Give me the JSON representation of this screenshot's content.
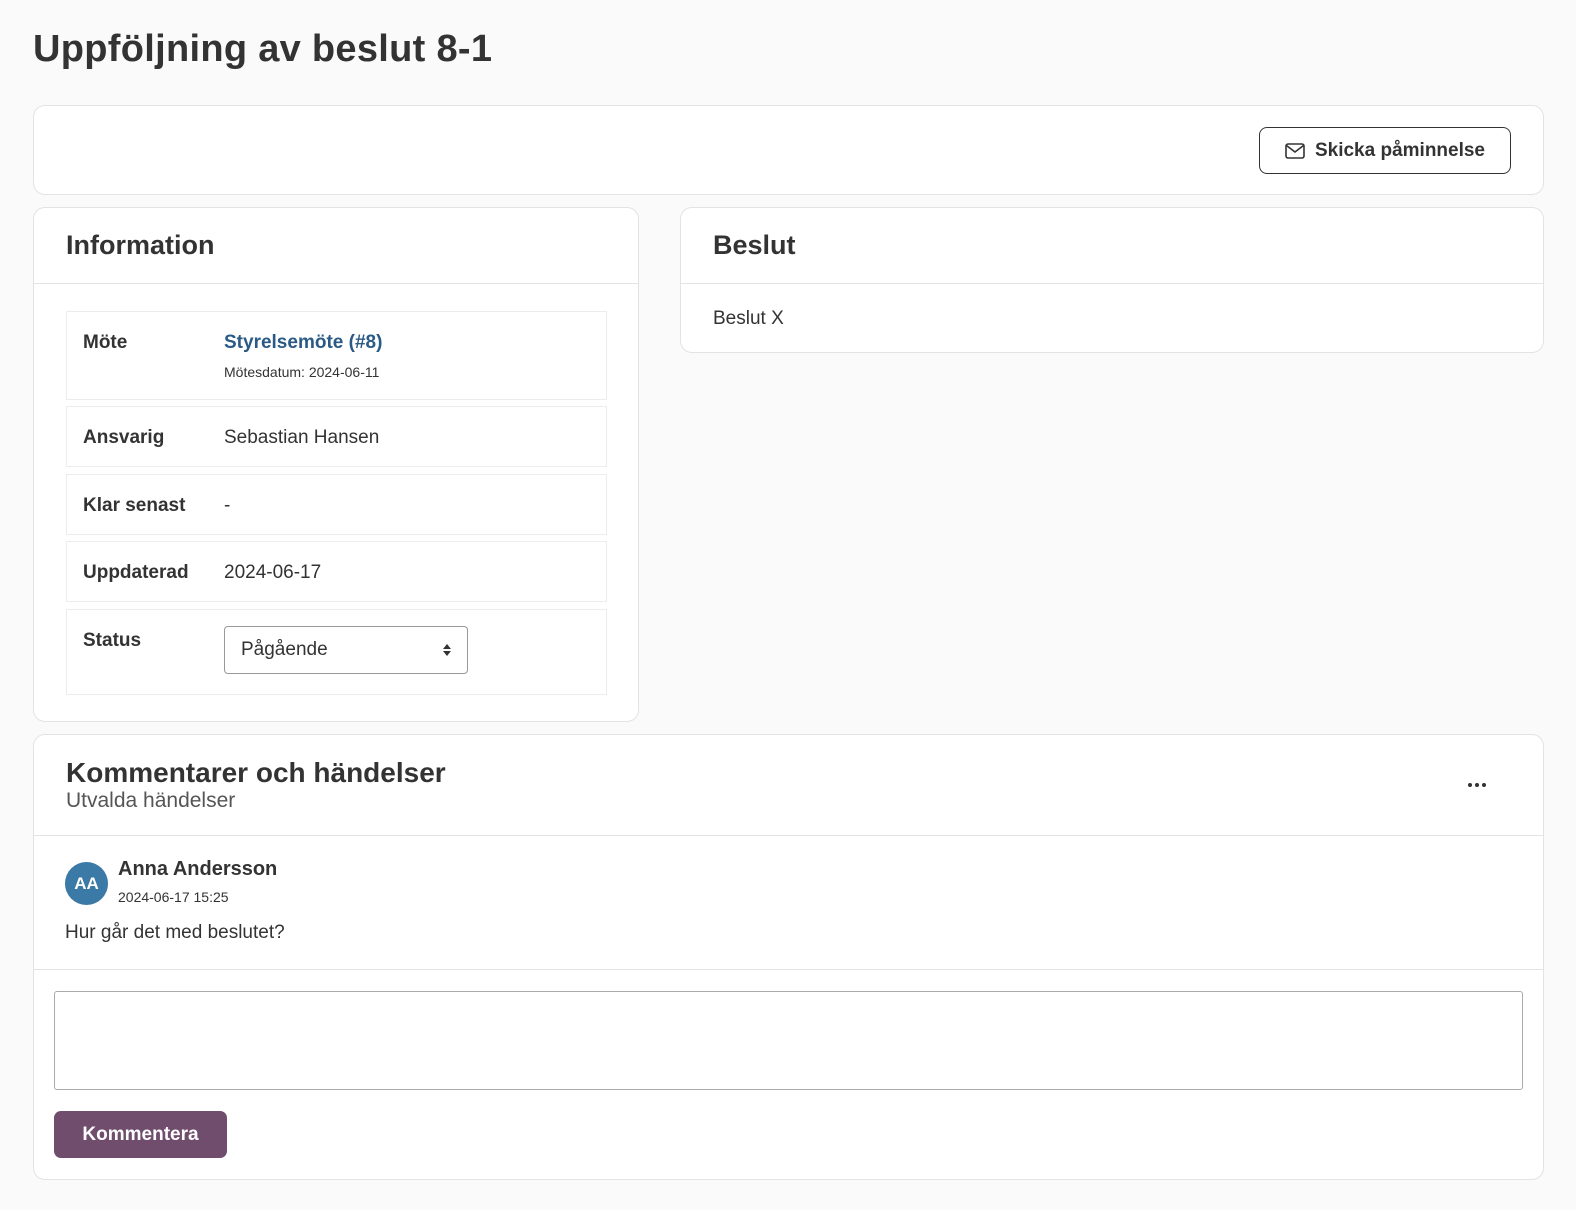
{
  "page": {
    "title": "Uppföljning av beslut 8-1"
  },
  "toolbar": {
    "reminder_label": "Skicka påminnelse",
    "reminder_icon": "envelope-icon"
  },
  "information": {
    "title": "Information",
    "meeting": {
      "label": "Möte",
      "link_text": "Styrelsemöte (#8)",
      "date_text": "Mötesdatum: 2024-06-11"
    },
    "responsible": {
      "label": "Ansvarig",
      "value": "Sebastian Hansen"
    },
    "due": {
      "label": "Klar senast",
      "value": "-"
    },
    "updated": {
      "label": "Uppdaterad",
      "value": "2024-06-17"
    },
    "status": {
      "label": "Status",
      "selected": "Pågående"
    }
  },
  "decision": {
    "title": "Beslut",
    "text": "Beslut X"
  },
  "comments": {
    "title": "Kommentarer och händelser",
    "subtitle": "Utvalda händelser",
    "items": [
      {
        "initials": "AA",
        "author": "Anna Andersson",
        "time": "2024-06-17 15:25",
        "text": "Hur går det med beslutet?"
      }
    ],
    "input_value": "",
    "submit_label": "Kommentera"
  },
  "colors": {
    "link": "#2a5a86",
    "avatar": "#3b79a6",
    "primary_button": "#704d6d"
  }
}
